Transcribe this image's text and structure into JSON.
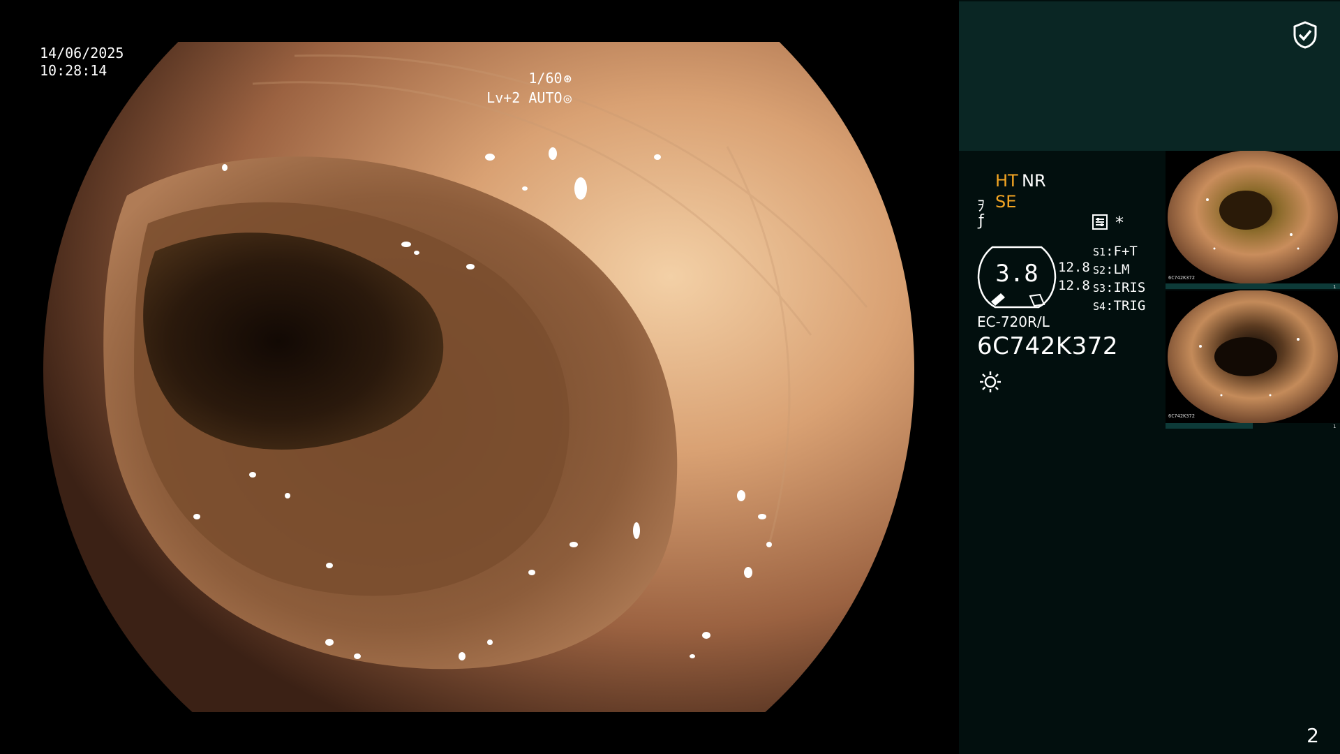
{
  "overlay": {
    "date": "14/06/2025",
    "time": "10:28:14",
    "shutter": "1/60",
    "shutter_icon": "aperture-icon",
    "level": "Lv+2 AUTO",
    "level_icon": "iris-icon"
  },
  "status_panel": {
    "ht_label": "HT",
    "nr_label": "NR",
    "se_label": "SE",
    "mode_icon_1": "scope-mode-icon",
    "mode_icon_2": "flat-icon",
    "settings_icon": "sliders-icon",
    "asterisk": "*",
    "gauge_value": "3.8",
    "brightness_1": "12.8",
    "brightness_2": "12.8",
    "switches": [
      {
        "key": "S1",
        "value": "F+T"
      },
      {
        "key": "S2",
        "value": "LM"
      },
      {
        "key": "S3",
        "value": "IRIS"
      },
      {
        "key": "S4",
        "value": "TRIG"
      }
    ],
    "model": "EC-720R/L",
    "serial": "6C742K372",
    "light_icon": "light-source-icon",
    "accent_color": "#f5a623"
  },
  "top_right": {
    "icon": "shield-check-icon"
  },
  "thumbnails": [
    {
      "caption_left": "6C742K372",
      "caption_right": "1"
    },
    {
      "caption_left": "6C742K372",
      "caption_right": "1"
    }
  ],
  "page_number": "2"
}
